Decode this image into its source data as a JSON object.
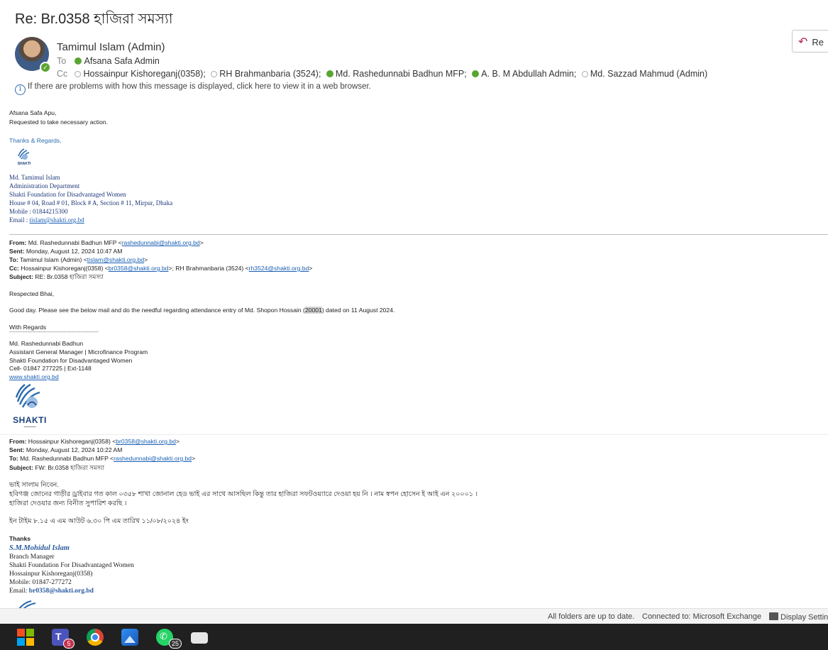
{
  "email": {
    "subject": "Re: Br.0358 হাজিরা সমস্যা",
    "sender": "Tamimul Islam (Admin)",
    "to_label": "To",
    "to": "Afsana Safa Admin",
    "cc_label": "Cc",
    "cc": [
      "Hossainpur Kishoreganj(0358);",
      "RH Brahmanbaria (3524);",
      "Md. Rashedunnabi Badhun MFP;",
      "A. B. M Abdullah Admin;",
      "Md. Sazzad Mahmud (Admin)"
    ],
    "info_text": "If there are problems with how this message is displayed, click here to view it in a web browser.",
    "reply_label": "Re"
  },
  "body": {
    "greeting": "Afsana Safa Apu,",
    "request": "Requested to take necessary action.",
    "thanks": "Thanks & Regards,",
    "logo_small": "SHAKTI",
    "sig": {
      "name": "Md. Tamimul Islam",
      "dept": "Administration Department",
      "org": "Shakti Foundation for Disadvantaged Women",
      "address": "House # 04, Road # 01, Block # A, Section # 11, Mirpur, Dhaka",
      "mobile": "Mobile : 01844215300",
      "email_label": "Email : ",
      "email": "tislam@shakti.org.bd"
    },
    "fwd1": {
      "from_label": "From:",
      "from": "Md. Rashedunnabi Badhun MFP <",
      "from_email": "rashedunnabi@shakti.org.bd",
      "sent_label": "Sent:",
      "sent": "Monday, August 12, 2024 10:47 AM",
      "to_label": "To:",
      "to": "Tamimul Islam (Admin) <",
      "to_email": "tislam@shakti.org.bd",
      "cc_label": "Cc:",
      "cc1": "Hossainpur Kishoreganj(0358) <",
      "cc1_email": "br0358@shakti.org.bd",
      "cc2": ">; RH Brahmanbaria (3524) <",
      "cc2_email": "rh3524@shakti.org.bd",
      "subject_label": "Subject:",
      "subject": "RE: Br.0358 হাজিরা সমস্যা",
      "salutation": "Respected Bhai,",
      "msg_a": "Good day. Please see the below mail and do the needful regarding attendance entry of Md. Shopon Hossain (",
      "msg_hl": "20001",
      "msg_b": ") dated on 11 August 2024.",
      "regards": "With Regards",
      "dashes": "------------------------------------------------------",
      "name": "Md. Rashedunnabi Badhun",
      "title": "Assistant General Manager | Microfinance Program",
      "org": "Shakti Foundation for Disadvantaged Women",
      "cell": "Cell- 01847 277225 | Ext-1148",
      "web": "www.shakti.org.bd",
      "logo": "SHAKTI"
    },
    "fwd2": {
      "from_label": "From:",
      "from": "Hossainpur Kishoreganj(0358) <",
      "from_email": "br0358@shakti.org.bd",
      "sent_label": "Sent:",
      "sent": "Monday, August 12, 2024 10:22 AM",
      "to_label": "To:",
      "to": "Md. Rashedunnabi Badhun MFP <",
      "to_email": "rashedunnabi@shakti.org.bd",
      "subject_label": "Subject:",
      "subject": "FW: Br.0358 হাজিরা সমস্যা",
      "line1": "ভাই সালাম নিবেন.",
      "line2": "হবিগঞ্জ জোনের গাড়ীর ড্রাইবার গত কাল ০৩৫৮ শাখা জোনাল হেড ভাই এর সাথে আসছিল কিন্তু তার হাজিরা সফটওয়্যারে দেওয়া হয় নি । নাম স্বপন হোসেন ই আই এন ২০০০১ ।",
      "line3": "হাজিরা দেওয়ার জন্য বিনীত সুপারিশ করছি ।",
      "line4": "ইন টাইম ৮.১৫ এ এম আউট ৬.৩০ পি এম তারিখ ১১/০৮/২০২৪ ইং",
      "thanks": "Thanks",
      "name": "S.M.Mohidul Islam",
      "title": "Branch Manager",
      "org": "Shakti Foundation For Disadvantaged Women",
      "branch": "Hossainpur  Kishoreganj(0358)",
      "mobile": "Mobile: 01847-277272",
      "email_label": "Email:",
      "email": "br0358@shakti.org.bd"
    }
  },
  "status": {
    "folders": "All folders are up to date.",
    "connection": "Connected to: Microsoft Exchange",
    "display": "Display Settings"
  },
  "taskbar": {
    "teams_badge": "5",
    "whatsapp_badge": "25"
  }
}
